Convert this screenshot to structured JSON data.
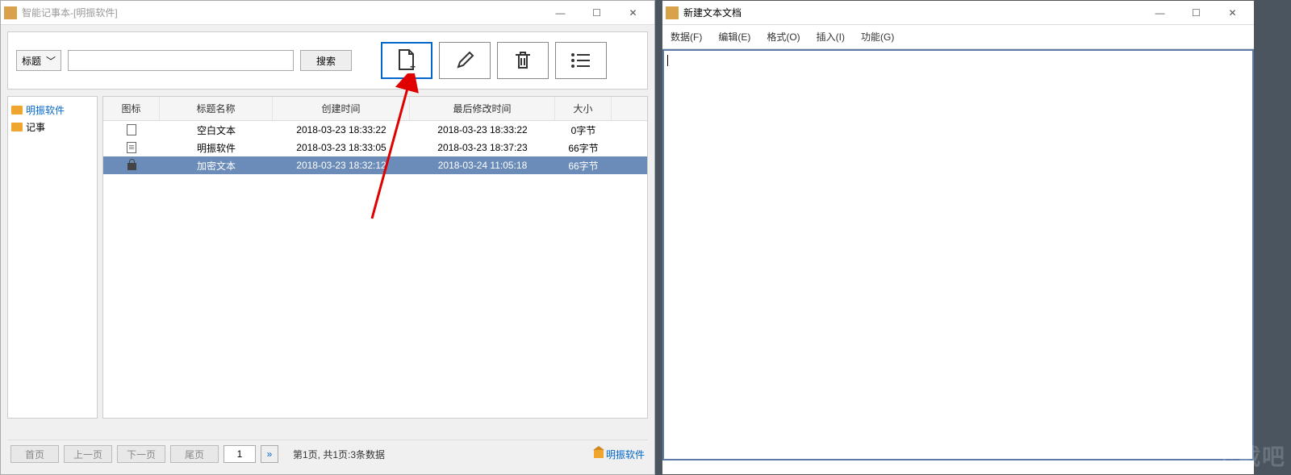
{
  "leftWindow": {
    "title": "智能记事本-[明振软件]",
    "toolbar": {
      "searchMode": "标题",
      "searchValue": "",
      "searchBtn": "搜索"
    },
    "sidebar": {
      "items": [
        {
          "label": "明振软件",
          "active": true
        },
        {
          "label": "记事",
          "active": false
        }
      ]
    },
    "list": {
      "headers": {
        "icon": "图标",
        "title": "标题名称",
        "created": "创建时间",
        "modified": "最后修改时间",
        "size": "大小"
      },
      "rows": [
        {
          "iconType": "page",
          "title": "空白文本",
          "created": "2018-03-23 18:33:22",
          "modified": "2018-03-23 18:33:22",
          "size": "0字节",
          "selected": false
        },
        {
          "iconType": "page-lines",
          "title": "明振软件",
          "created": "2018-03-23 18:33:05",
          "modified": "2018-03-23 18:37:23",
          "size": "66字节",
          "selected": false
        },
        {
          "iconType": "lock",
          "title": "加密文本",
          "created": "2018-03-23 18:32:12",
          "modified": "2018-03-24 11:05:18",
          "size": "66字节",
          "selected": true
        }
      ]
    },
    "pager": {
      "first": "首页",
      "prev": "上一页",
      "next": "下一页",
      "last": "尾页",
      "pageInput": "1",
      "go": "»",
      "status": "第1页, 共1页:3条数据",
      "footerLink": "明振软件"
    }
  },
  "rightWindow": {
    "title": "新建文本文档",
    "menu": [
      "数据(F)",
      "编辑(E)",
      "格式(O)",
      "插入(I)",
      "功能(G)"
    ],
    "content": ""
  },
  "watermark": "下载吧"
}
